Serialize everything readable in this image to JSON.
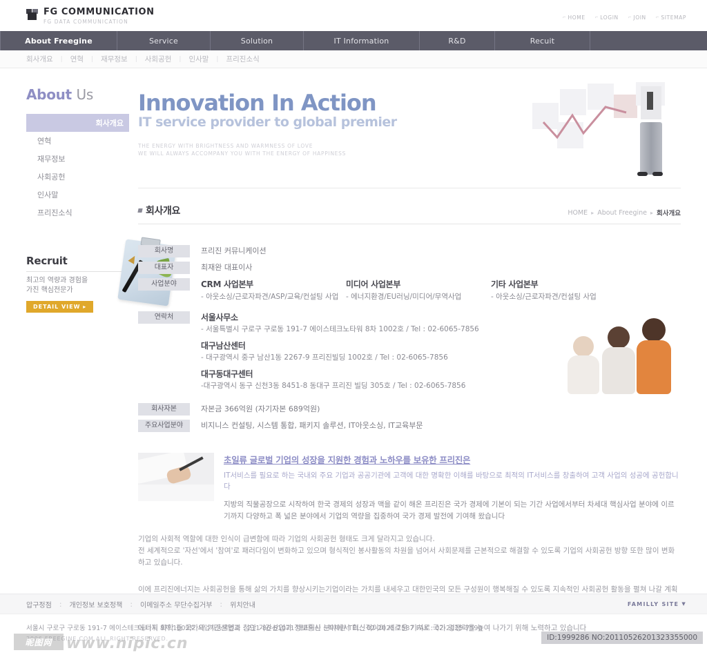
{
  "header": {
    "logo_title": "FG COMMUNICATION",
    "logo_sub": "FG DATA COMMUNICATION",
    "top_links": [
      {
        "label": "HOME",
        "icon": "corner-arrow-icon"
      },
      {
        "label": "LOGIN",
        "icon": "corner-arrow-icon"
      },
      {
        "label": "JOIN",
        "icon": "corner-arrow-icon"
      },
      {
        "label": "SITEMAP",
        "icon": "corner-arrow-icon"
      }
    ]
  },
  "mainnav": [
    {
      "label": "About Freegine",
      "active": true
    },
    {
      "label": "Service",
      "active": false
    },
    {
      "label": "Solution",
      "active": false
    },
    {
      "label": "IT Information",
      "active": false
    },
    {
      "label": "R&D",
      "active": false
    },
    {
      "label": "Recuit",
      "active": false
    }
  ],
  "subnav": [
    "회사개요",
    "연혁",
    "재무정보",
    "사회공헌",
    "인사말",
    "프리진소식"
  ],
  "sidebar": {
    "title_strong": "About",
    "title_light": "Us",
    "items": [
      {
        "label": "회사개요",
        "active": true
      },
      {
        "label": "연혁",
        "active": false
      },
      {
        "label": "재무정보",
        "active": false
      },
      {
        "label": "사회공헌",
        "active": false
      },
      {
        "label": "인사말",
        "active": false
      },
      {
        "label": "프리진소식",
        "active": false
      }
    ],
    "recruit": {
      "title": "Recruit",
      "desc_line1": "최고의 역량과 경험을",
      "desc_line2": "가진 핵심전문가",
      "button": "DETAIL VIEW ▸"
    }
  },
  "hero": {
    "headline": "Innovation In Action",
    "subhead": "IT service provider to global premier",
    "tag_line1": "THE ENERGY WITH BRIGHTNESS AND WARMNESS OF LOVE",
    "tag_line2": "WE WILL ALWAYS ACCOMPANY YOU WITH THE ENERGY OF HAPPINESS"
  },
  "section": {
    "title": "회사개요",
    "breadcrumb": [
      {
        "label": "HOME",
        "current": false
      },
      {
        "label": "About Freegine",
        "current": false
      },
      {
        "label": "회사개요",
        "current": true
      }
    ]
  },
  "info": {
    "company_name_label": "회사명",
    "company_name_value": "프리진 커뮤니케이션",
    "ceo_label": "대표자",
    "ceo_value": "최재완 대표이사",
    "business_label": "사업분야",
    "business_divisions": [
      {
        "title": "CRM 사업본부",
        "detail": "- 아웃소싱/근로자파견/ASP/교육/컨설팅 사업"
      },
      {
        "title": "미디어 사업본부",
        "detail": "- 에너지환경/EU러닝/미디어/무역사업"
      },
      {
        "title": "기타 사업본부",
        "detail": "- 아웃소싱/근로자파견/컨설팅 사업"
      }
    ],
    "contact_label": "연락처",
    "offices": [
      {
        "name": "서울사무소",
        "line": "- 서울특별시 구로구 구로동 191-7 에이스테크노타워 8차 1002호  /  Tel : 02-6065-7856"
      },
      {
        "name": "대구남산센터",
        "line": "- 대구광역시 중구 남산1동 2267-9 프리진빌딩 1002호  /  Tel : 02-6065-7856"
      },
      {
        "name": "대구동대구센터",
        "line": "-대구광역시 동구 신천3동 8451-8 동대구 프리진 빌딩 305호  /  Tel : 02-6065-7856"
      }
    ],
    "capital_label": "회사자본",
    "capital_value": "자본금 366억원 (자기자본 689억원)",
    "main_biz_label": "주요사업분야",
    "main_biz_value": "비지니스 컨설팅, 시스템 통합, 패키지 솔루션, IT아웃소싱, IT교육부문"
  },
  "highlight": {
    "heading": "초일류 글로벌 기업의 성장을 지원한 경험과 노하우를 보유한 프리진은",
    "lead": "IT서비스를 필요로 하는 국내외 주요 기업과 공공기관에 고객에 대한 명확한 이해를 바탕으로 최적의 IT서비스를 창출하여 고객 사업의 성공에 공헌합니다",
    "body": "지방의 직물공장으로 시작하여 한국 경제의 성장과 맥을 같이 해온 프리진은 국가 경제에 기본이 되는 기간 사업에서부터 차세대 핵심사업 분야에 이르기까지 다양하고 폭 넓은 분야에서 기업의 역량을 집중하여 국가 경제 발전에 기여해 왔습니다"
  },
  "paragraphs": [
    "기업의 사회적 역할에 대한 인식이 급변함에 따라 기업의 사회공헌 형태도 크게 달라지고 있습니다.\n전 세계적으로 '자선'에서 '참여'로 패러다임이 변화하고 있으며 형식적인 봉사활동의 차원을 넘어서 사회문제를 근본적으로 해결할 수 있도록 기업의 사회공헌 방향 또한 많이 변화하고 있습니다.",
    "이에 프리진에너지는 사회공헌을 통해 삶의 가치를 향상시키는기업이라는 가치를 내세우고 대한민국의 모든 구성원이 행복해질 수 있도록 지속적인 사회공헌 활동을 펼쳐 나갈 계획입니다",
    "에너지 화학 등 국가의 기간산업과 첨단 기간산업과 정보통신 분야에서 혁신적이며 새로운 기치로 국가 경쟁력을 높여 나가기 위해 노력하고 있습니다"
  ],
  "footer": {
    "links": [
      "압구정점",
      "개인정보 보호정책",
      "이메일주소 무단수집거부",
      "위치안내"
    ],
    "family_site": "FAMILLY SITE",
    "address": "서울시 구로구 구로동 191-7 에이스테크노타워 8차 1002호  사업자등록번호 : 211-86-61071  대표이사 : 최재완    TEL : 02-2025-7587   FAX : 02-2025-7590",
    "copyright": "2006 FREEGINE.COM ALL RIGHT RESERVED.",
    "watermark": "www.nipic.cn",
    "watermark_badge": "昵图网",
    "id_tag": "ID:1999286 NO:20110526201323355000"
  }
}
